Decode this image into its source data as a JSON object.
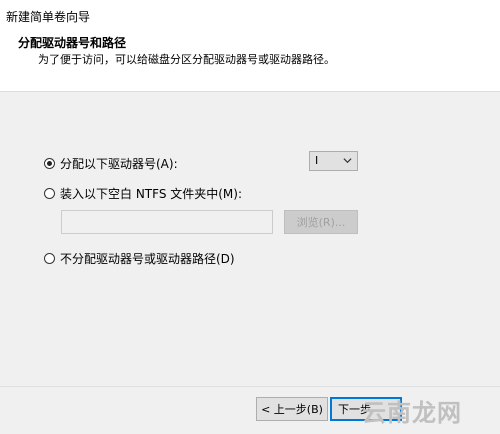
{
  "window": {
    "title": "新建简单卷向导"
  },
  "header": {
    "title": "分配驱动器号和路径",
    "description": "为了便于访问，可以给磁盘分区分配驱动器号或驱动器路径。"
  },
  "options": {
    "assign_letter": {
      "label": "分配以下驱动器号(A):",
      "selected": true
    },
    "mount_folder": {
      "label": "装入以下空白 NTFS 文件夹中(M):",
      "selected": false
    },
    "no_assign": {
      "label": "不分配驱动器号或驱动器路径(D)",
      "selected": false
    }
  },
  "drive_select": {
    "value": "I",
    "icon": "chevron-down-icon"
  },
  "path_input": {
    "value": "",
    "enabled": false
  },
  "buttons": {
    "browse": "浏览(R)...",
    "back": "< 上一步(B)",
    "next": "下一步"
  },
  "watermark": "云南龙网",
  "colors": {
    "accent": "#0078d7",
    "content_bg": "#f0f0f0",
    "header_bg": "#ffffff"
  }
}
